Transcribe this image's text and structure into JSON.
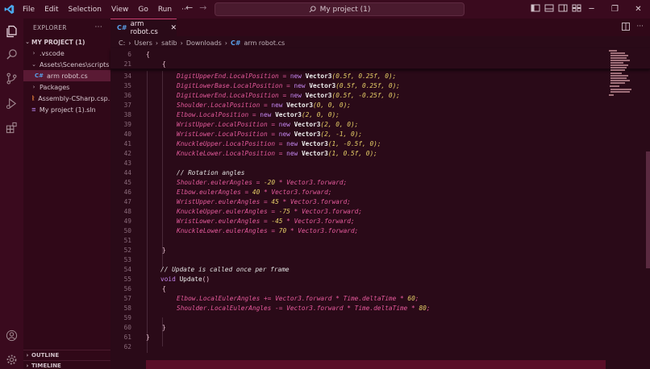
{
  "titlebar": {
    "menu": [
      "File",
      "Edit",
      "Selection",
      "View",
      "Go",
      "Run",
      "···"
    ],
    "search_text": "My project (1)",
    "nav_back": "←",
    "nav_forward": "→"
  },
  "sidebar": {
    "header": "EXPLORER",
    "more": "···",
    "project": "MY PROJECT (1)",
    "items": [
      {
        "label": ".vscode",
        "chev": "›"
      },
      {
        "label": "Assets\\Scenes\\scripts",
        "chev": "⌄"
      },
      {
        "label": "arm robot.cs",
        "icon": "C#"
      },
      {
        "label": "Packages",
        "chev": "›"
      },
      {
        "label": "Assembly-CSharp.csp...",
        "icon": "ᚱ"
      },
      {
        "label": "My project (1).sln",
        "icon": "≡"
      }
    ],
    "outline": "OUTLINE",
    "timeline": "TIMELINE"
  },
  "editor": {
    "tab": {
      "icon": "C#",
      "label": "arm robot.cs",
      "close": "✕"
    },
    "breadcrumb": [
      "C:",
      "Users",
      "satib",
      "Downloads",
      "arm robot.cs"
    ],
    "breadcrumb_icon": "C#",
    "sticky": [
      {
        "n": "6",
        "t": "{"
      },
      {
        "n": "21",
        "t": "{"
      }
    ],
    "lines": [
      {
        "n": "34"
      },
      {
        "n": "35"
      },
      {
        "n": "36"
      },
      {
        "n": "37"
      },
      {
        "n": "38"
      },
      {
        "n": "39"
      },
      {
        "n": "40"
      },
      {
        "n": "41"
      },
      {
        "n": "42"
      },
      {
        "n": "43"
      },
      {
        "n": "44"
      },
      {
        "n": "45"
      },
      {
        "n": "46"
      },
      {
        "n": "47"
      },
      {
        "n": "48"
      },
      {
        "n": "49"
      },
      {
        "n": "50"
      },
      {
        "n": "51"
      },
      {
        "n": "52"
      },
      {
        "n": "53"
      },
      {
        "n": "54"
      },
      {
        "n": "55"
      },
      {
        "n": "56"
      },
      {
        "n": "57"
      },
      {
        "n": "58"
      },
      {
        "n": "59"
      },
      {
        "n": "60"
      },
      {
        "n": "61"
      },
      {
        "n": "62"
      }
    ],
    "code": {
      "l34": [
        "DigitUpperEnd",
        ".LocalPosition = ",
        "new",
        "Vector3",
        "(0.5f, 0.25f, 0);"
      ],
      "l35": [
        "DigitLowerBase",
        ".LocalPosition = ",
        "new",
        "Vector3",
        "(0.5f, 0.25f, 0);"
      ],
      "l36": [
        "DigitLowerEnd",
        ".LocalPosition = ",
        "new",
        "Vector3",
        "(0.5f, -0.25f, 0);"
      ],
      "l37": [
        "Shoulder",
        ".LocalPosition = ",
        "new",
        "Vector3",
        "(0, 0, 0);"
      ],
      "l38": [
        "Elbow",
        ".LocalPosition = ",
        "new",
        "Vector3",
        "(2, 0, 0);"
      ],
      "l39": [
        "WristUpper",
        ".LocalPosition = ",
        "new",
        "Vector3",
        "(2, 0, 0);"
      ],
      "l40": [
        "WristLower",
        ".LocalPosition = ",
        "new",
        "Vector3",
        "(2, -1, 0);"
      ],
      "l41": [
        "KnuckleUpper",
        ".LocalPosition = ",
        "new",
        "Vector3",
        "(1, -0.5f, 0);"
      ],
      "l42": [
        "KnuckleLower",
        ".LocalPosition = ",
        "new",
        "Vector3",
        "(1, 0.5f, 0);"
      ],
      "l44": "// Rotation angles",
      "l45": [
        "Shoulder",
        ".eulerAngles = ",
        "-20",
        " * ",
        "Vector3",
        ".forward;"
      ],
      "l46": [
        "Elbow",
        ".eulerAngles = ",
        "40",
        " * ",
        "Vector3",
        ".forward;"
      ],
      "l47": [
        "WristUpper",
        ".eulerAngles = ",
        "45",
        " * ",
        "Vector3",
        ".forward;"
      ],
      "l48": [
        "KnuckleUpper",
        ".eulerAngles = ",
        "-75",
        " * ",
        "Vector3",
        ".forward;"
      ],
      "l49": [
        "WristLower",
        ".eulerAngles = ",
        "-45",
        " * ",
        "Vector3",
        ".forward;"
      ],
      "l50": [
        "KnuckleLower",
        ".eulerAngles = ",
        "70",
        " * ",
        "Vector3",
        ".forward;"
      ],
      "l52": "}",
      "l54": "// Update is called once per frame",
      "l55": [
        "void",
        "Update",
        "()"
      ],
      "l56": "{",
      "l57": [
        "Elbow",
        ".LocalEulerAngles += ",
        "Vector3",
        ".forward * ",
        "Time",
        ".deltaTime * ",
        "60",
        ";"
      ],
      "l58": [
        "Shoulder",
        ".LocalEulerAngles -= ",
        "Vector3",
        ".forward * ",
        "Time",
        ".deltaTime * ",
        "80",
        ";"
      ],
      "l60": "}",
      "l61": "}"
    }
  },
  "colors": {
    "accent": "#c83e6e",
    "background": "#2a0a18",
    "titlebar": "#3a0a1e"
  }
}
